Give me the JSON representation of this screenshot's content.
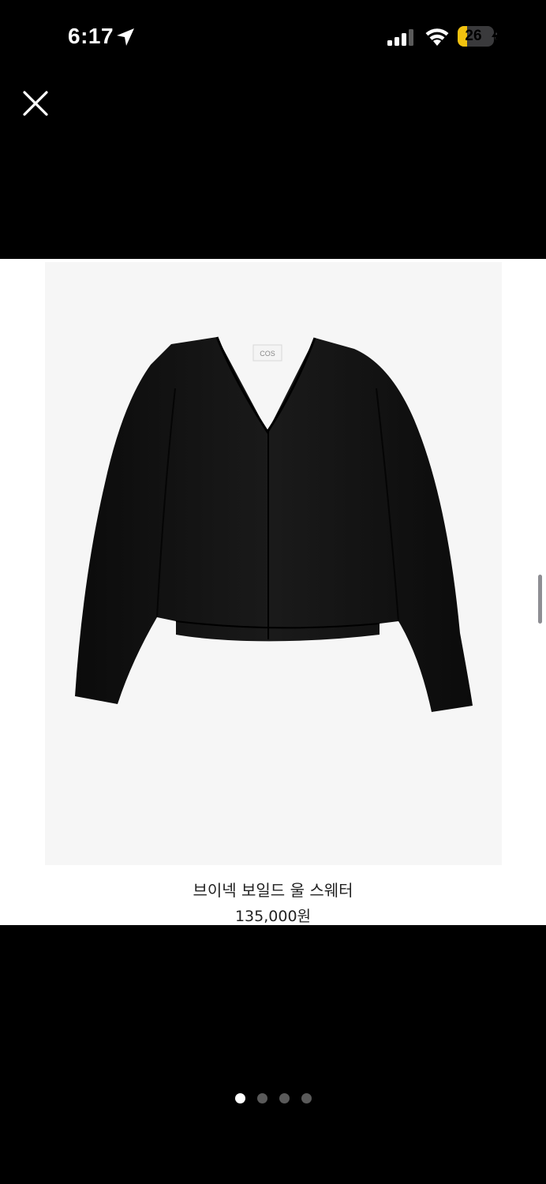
{
  "status_bar": {
    "time": "6:17",
    "battery_level": "26",
    "battery_fraction": 0.26,
    "battery_color": "#f2c20f"
  },
  "product": {
    "brand_label": "COS",
    "title": "브이넥 보일드 울 스웨터",
    "price": "135,000원",
    "image_background": "#f6f6f6"
  },
  "icons": {
    "close": "close-icon",
    "location": "location-arrow-icon",
    "signal": "cellular-signal-icon",
    "wifi": "wifi-icon",
    "battery": "battery-charging-icon"
  },
  "pagination": {
    "total_pages": 4,
    "current_page": 1
  }
}
